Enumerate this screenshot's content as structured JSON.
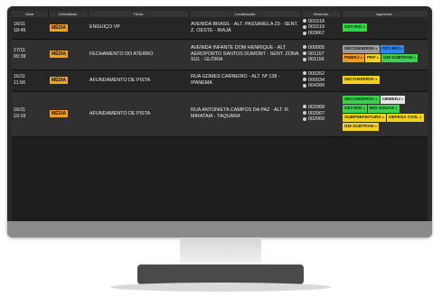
{
  "columns": [
    "Data",
    "Criticidade",
    "Título",
    "Localização",
    "Câmeras",
    "Agências"
  ],
  "rows": [
    {
      "date": "16/11",
      "time": "18:45",
      "crit": "MÉDIA",
      "title": "ENGUIÇO VP",
      "loc": "AVENIDA BRASIL - ALT. PASSARELA 23 - SENT. Z. OESTE - IRAJÁ",
      "cams": [
        "001518",
        "001519",
        "003667"
      ],
      "agencies": [
        {
          "label": "CET-RIO",
          "style": "green"
        }
      ]
    },
    {
      "date": "17/11",
      "time": "00:39",
      "crit": "MÉDIA",
      "title": "FECHAMENTO DO ATERRO",
      "loc": "AVENIDA INFANTE DOM HENRIQUE - ALT. AEROPORTO SANTOS DUMONT - SENT. ZONA SUL - GLÓRIA",
      "cams": [
        "000005",
        "001157",
        "001156"
      ],
      "agencies": [
        {
          "label": "SECONSERVA",
          "style": "gray"
        },
        {
          "label": "CET-RIO",
          "style": "blue"
        },
        {
          "label": "PMERJ",
          "style": "orange"
        },
        {
          "label": "PRF",
          "style": "yellow"
        },
        {
          "label": "GM SUBTRAN",
          "style": "green"
        }
      ]
    },
    {
      "date": "16/11",
      "time": "11:56",
      "crit": "MÉDIA",
      "title": "AFUNDAMENTO DE PISTA",
      "loc": "RUA GOMES CARNEIRO - ALT. Nº 138 - IPANEMA",
      "cams": [
        "000252",
        "000034",
        "004289"
      ],
      "agencies": [
        {
          "label": "SECONSERVA",
          "style": "yellow"
        }
      ]
    },
    {
      "date": "16/11",
      "time": "10:16",
      "crit": "MÉDIA",
      "title": "AFUNDAMENTO DE PISTA",
      "loc": "RUA ANTONIETA CAMPOS DA PAZ - ALT. R. MIRATAIA - TAQUARA",
      "cams": [
        "002068",
        "002067",
        "002069"
      ],
      "agencies": [
        {
          "label": "SECONSERVA",
          "style": "green"
        },
        {
          "label": "CBMERJ",
          "style": "white"
        },
        {
          "label": "CET-RIO",
          "style": "green"
        },
        {
          "label": "RIO ÁGUAS",
          "style": "green"
        },
        {
          "label": "SUBPREFEITURA",
          "style": "yellow"
        },
        {
          "label": "DEFESA CIVIL",
          "style": "yellow"
        },
        {
          "label": "GM SUBTRAN",
          "style": "yellow"
        }
      ]
    }
  ],
  "agency_colors": {
    "green": {
      "bg": "#3bd14d",
      "fg": "#0b2a0e"
    },
    "blue": {
      "bg": "#2d86e8",
      "fg": "#08203d"
    },
    "gray": {
      "bg": "#9a9a9a",
      "fg": "#111111"
    },
    "orange": {
      "bg": "#f79a1e",
      "fg": "#2b1600"
    },
    "yellow": {
      "bg": "#f2d21c",
      "fg": "#2a2400"
    },
    "white": {
      "bg": "#e6e6e6",
      "fg": "#222222"
    }
  }
}
